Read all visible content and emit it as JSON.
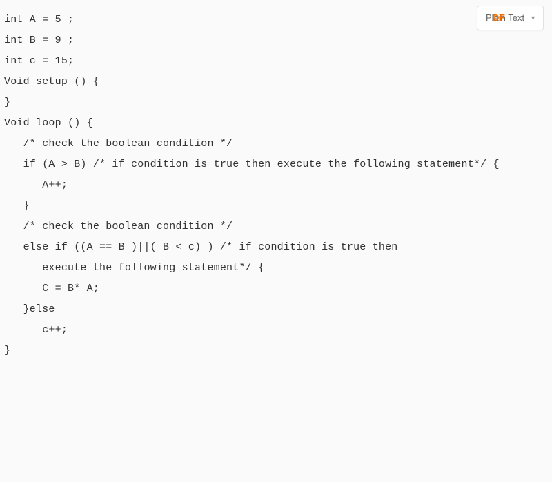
{
  "dropdown": {
    "label": "Plain Text",
    "overlay": "DF"
  },
  "code": {
    "lines": [
      "int A = 5 ;",
      "int B = 9 ;",
      "int c = 15;",
      "",
      "Void setup () {",
      "",
      "}",
      "",
      "Void loop () {",
      "   /* check the boolean condition */",
      "   if (A > B) /* if condition is true then execute the following statement*/ {",
      "      A++;",
      "   }",
      "   /* check the boolean condition */",
      "   else if ((A == B )||( B < c) ) /* if condition is true then ",
      "      execute the following statement*/ {",
      "      C = B* A;",
      "   }else",
      "      c++;",
      "}"
    ]
  }
}
